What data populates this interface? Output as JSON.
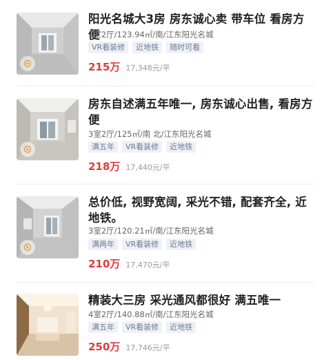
{
  "listings": [
    {
      "title": "阳光名城大3房 房东诚心卖 带车位 看房方便",
      "meta": "3室2厅/123.94㎡/南/江东阳光名城",
      "tags": [
        "VR看装修",
        "近地铁",
        "随时可看"
      ],
      "price": "215万",
      "unit_price": "17,348元/平"
    },
    {
      "title": "房东自述满五年唯一, 房东诚心出售, 看房方便",
      "meta": "3室2厅/125㎡/南 北/江东阳光名城",
      "tags": [
        "满五年",
        "VR看装修",
        "近地铁"
      ],
      "price": "218万",
      "unit_price": "17,440元/平"
    },
    {
      "title": "总价低, 视野宽阔, 采光不错, 配套齐全, 近地铁。",
      "meta": "3室2厅/120.21㎡/南/江东阳光名城",
      "tags": [
        "满两年",
        "VR看装修",
        "近地铁"
      ],
      "price": "210万",
      "unit_price": "17,470元/平"
    },
    {
      "title": "精装大三房 采光通风都很好 满五唯一",
      "meta": "4室2厅/140.88㎡/南/江东阳光名城",
      "tags": [
        "满五年",
        "VR看装修",
        "近地铁"
      ],
      "price": "250万",
      "unit_price": "17,746元/平"
    }
  ]
}
